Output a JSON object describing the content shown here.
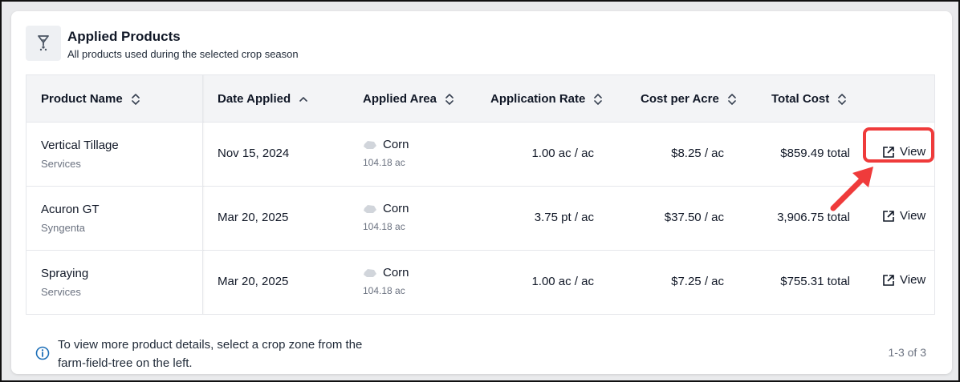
{
  "header": {
    "icon": "funnel-hourglass-icon",
    "title": "Applied Products",
    "subtitle": "All products used during the selected crop season"
  },
  "table": {
    "columns": [
      {
        "label": "Product Name",
        "sort": "unsorted"
      },
      {
        "label": "Date Applied",
        "sort": "ascending"
      },
      {
        "label": "Applied Area",
        "sort": "unsorted"
      },
      {
        "label": "Application Rate",
        "sort": "unsorted"
      },
      {
        "label": "Cost per Acre",
        "sort": "unsorted"
      },
      {
        "label": "Total Cost",
        "sort": "unsorted"
      }
    ],
    "rows": [
      {
        "product": "Vertical Tillage",
        "vendor": "Services",
        "date": "Nov 15, 2024",
        "crop": "Corn",
        "area": "104.18 ac",
        "rate": "1.00 ac / ac",
        "cost_per_acre": "$8.25 / ac",
        "total": "$859.49 total",
        "action": "View"
      },
      {
        "product": "Acuron GT",
        "vendor": "Syngenta",
        "date": "Mar 20, 2025",
        "crop": "Corn",
        "area": "104.18 ac",
        "rate": "3.75 pt / ac",
        "cost_per_acre": "$37.50 / ac",
        "total": "3,906.75 total",
        "action": "View"
      },
      {
        "product": "Spraying",
        "vendor": "Services",
        "date": "Mar 20, 2025",
        "crop": "Corn",
        "area": "104.18 ac",
        "rate": "1.00 ac / ac",
        "cost_per_acre": "$7.25 / ac",
        "total": "$755.31 total",
        "action": "View"
      }
    ]
  },
  "footer": {
    "info_icon": "info-icon",
    "info_text": "To view more product details, select a crop zone from the farm-field-tree on the left.",
    "pagination": "1-3 of 3"
  },
  "annotation": {
    "highlight_color": "#ef3b3b",
    "highlighted_row": 1
  },
  "colors": {
    "header_bg": "#f3f4f6",
    "muted_text": "#6b7280",
    "info_blue": "#1d6fb8"
  }
}
